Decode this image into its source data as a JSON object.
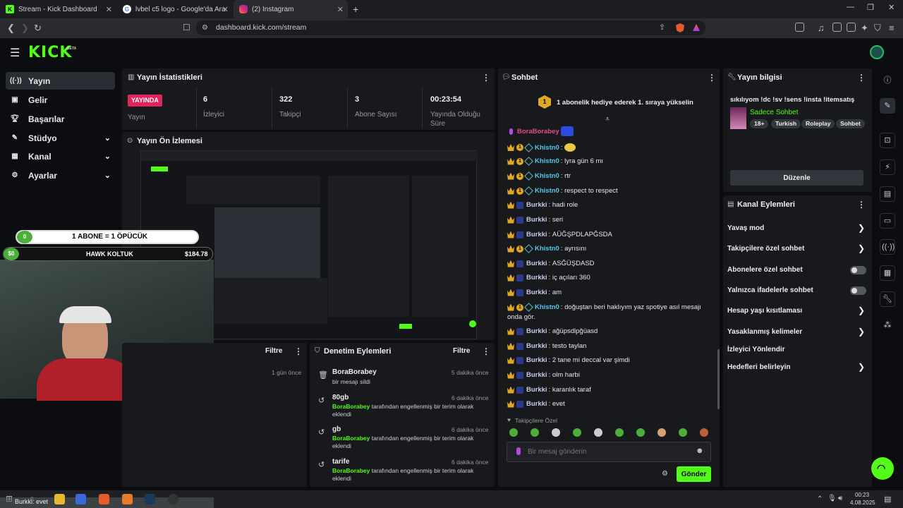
{
  "browser": {
    "tabs": [
      {
        "title": "Stream - Kick Dashboard",
        "active": false
      },
      {
        "title": "lvbel c5 logo - Google'da Ara",
        "active": false
      },
      {
        "title": "(2) Instagram",
        "active": true
      }
    ],
    "url": "dashboard.kick.com/stream"
  },
  "app": {
    "logo": "KICK",
    "beta": "BETA"
  },
  "sidebar": {
    "items": [
      {
        "label": "Yayın",
        "icon": "broadcast-icon",
        "active": true
      },
      {
        "label": "Gelir",
        "icon": "wallet-icon"
      },
      {
        "label": "Başarılar",
        "icon": "trophy-icon"
      },
      {
        "label": "Stüdyo",
        "icon": "studio-icon"
      },
      {
        "label": "Kanal",
        "icon": "channel-icon"
      },
      {
        "label": "Ayarlar",
        "icon": "gear-icon"
      }
    ]
  },
  "stats": {
    "title": "Yayın İstatistikleri",
    "live_badge": "YAYINDA",
    "live_label": "Yayın",
    "items": [
      {
        "value": "6",
        "label": "İzleyici"
      },
      {
        "value": "322",
        "label": "Takipçi"
      },
      {
        "value": "3",
        "label": "Abone Sayısı"
      },
      {
        "value": "00:23:54",
        "label": "Yayında Olduğu Süre"
      }
    ]
  },
  "preview": {
    "title": "Yayın Ön İzlemesi"
  },
  "overlay": {
    "sub_goal": "1 ABONE = 1 ÖPÜCÜK",
    "sub_count": "0",
    "donor_amount": "$0",
    "donor_name": "HAWK KOLTUK",
    "donor_value": "$184.78"
  },
  "activity": {
    "filter": "Filtre",
    "time": "1 gün önce"
  },
  "moderation": {
    "title": "Denetim Eylemleri",
    "filter": "Filtre",
    "entries": [
      {
        "user": "BoraBorabey",
        "time": "5 dakika önce",
        "desc": "bir mesajı sildi",
        "actor": ""
      },
      {
        "user": "80gb",
        "time": "6 dakika önce",
        "actor": "BoraBorabey",
        "desc": "tarafından engellenmiş bir terim olarak eklendi"
      },
      {
        "user": "gb",
        "time": "6 dakika önce",
        "actor": "BoraBorabey",
        "desc": "tarafından engellenmiş bir terim olarak eklendi"
      },
      {
        "user": "tarife",
        "time": "6 dakika önce",
        "actor": "BoraBorabey",
        "desc": "tarafından engellenmiş bir terim olarak eklendi"
      }
    ]
  },
  "chat": {
    "title": "Sohbet",
    "pinned": "1 abonelik hediye ederek 1. sıraya yükselin",
    "pinned_rank": "1",
    "messages": [
      {
        "user": "BoraBorabey",
        "text": "",
        "type": "mod"
      },
      {
        "user": "Khistn0",
        "text": "",
        "type": "sub"
      },
      {
        "user": "Khistn0",
        "text": "lyra gün 6 mı",
        "type": "sub"
      },
      {
        "user": "Khistn0",
        "text": "rtr",
        "type": "sub"
      },
      {
        "user": "Khistn0",
        "text": "respect to respect",
        "type": "sub"
      },
      {
        "user": "Burkki",
        "text": "hadi role",
        "type": "b"
      },
      {
        "user": "Burkki",
        "text": "seri",
        "type": "b"
      },
      {
        "user": "Burkki",
        "text": "AÜĞŞPDLAPĞSDA",
        "type": "b"
      },
      {
        "user": "Khistn0",
        "text": "ayrısını",
        "type": "sub"
      },
      {
        "user": "Burkki",
        "text": "ASĞÜŞDASD",
        "type": "b"
      },
      {
        "user": "Burkki",
        "text": "iç açıları 360",
        "type": "b"
      },
      {
        "user": "Burkki",
        "text": "am",
        "type": "b"
      },
      {
        "user": "Khistn0",
        "text": "doğuştan beri haklıyım yaz spotiye asıl mesajı",
        "text2": "onda gör.",
        "type": "sub"
      },
      {
        "user": "Burkki",
        "text": "ağüpsdlpğüasd",
        "type": "b"
      },
      {
        "user": "Burkki",
        "text": "testo taylan",
        "type": "b"
      },
      {
        "user": "Burkki",
        "text": "2 tane mi deccal var şimdi",
        "type": "b"
      },
      {
        "user": "Burkki",
        "text": "olm harbi",
        "type": "b"
      },
      {
        "user": "Burkki",
        "text": "karanlık taraf",
        "type": "b"
      },
      {
        "user": "Burkki",
        "text": "evet",
        "type": "b"
      }
    ],
    "followers_only": "Takipçilere Özel",
    "placeholder": "Bir mesaj gönderin",
    "send": "Gönder"
  },
  "stream_info": {
    "title": "Yayın bilgisi",
    "stream_title": "sıkılıyom !dc !sv !sens !insta !itemsatış",
    "category": "Sadece Sohbet",
    "tags": [
      "18+",
      "Turkish",
      "Roleplay",
      "Sohbet"
    ],
    "edit": "Düzenle"
  },
  "channel_actions": {
    "title": "Kanal Eylemleri",
    "items": [
      {
        "label": "Yavaş mod",
        "control": "chevron"
      },
      {
        "label": "Takipçilere özel sohbet",
        "control": "chevron"
      },
      {
        "label": "Abonelere özel sohbet",
        "control": "toggle"
      },
      {
        "label": "Yalnızca ifadelerle sohbet",
        "control": "toggle"
      },
      {
        "label": "Hesap yaşı kısıtlaması",
        "control": "chevron"
      },
      {
        "label": "Yasaklanmış kelimeler",
        "control": "chevron"
      },
      {
        "label": "İzleyici Yönlendir",
        "control": "none"
      },
      {
        "label": "Hedefleri belirleyin",
        "control": "chevron"
      }
    ]
  },
  "taskbar": {
    "time": "00:23",
    "date": "4.08.2025",
    "chat_preview": "Burkki: evet"
  },
  "colors": {
    "accent": "#53fc18",
    "live": "#e0245e",
    "panel": "#18191d",
    "bg": "#0b0d10"
  }
}
